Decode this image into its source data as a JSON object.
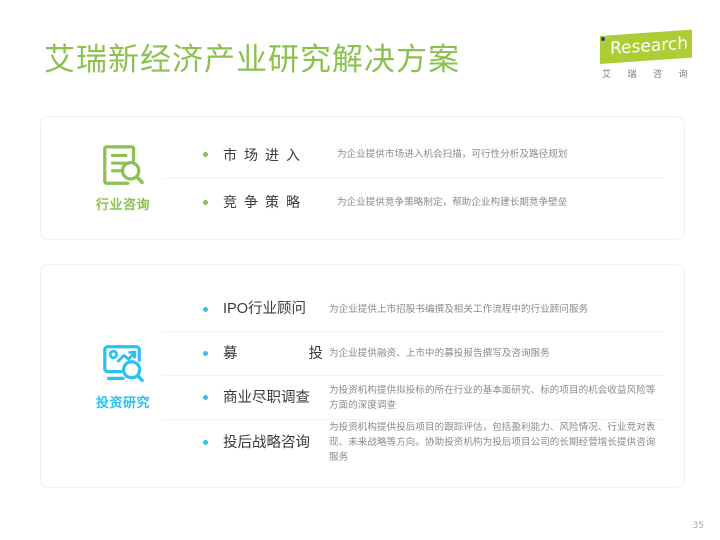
{
  "header": {
    "title": "艾瑞新经济产业研究解决方案",
    "title_color": "#8cc152",
    "logo": {
      "word": "Research",
      "cn": "艾 瑞 咨 询",
      "shape_color": "#aecc35",
      "dot_color": "#2c3e8f"
    }
  },
  "cards": [
    {
      "id": "industry",
      "icon_name": "document-search-icon",
      "label": "行业咨询",
      "accent": "#8cc152",
      "rows": [
        {
          "title": "市场进入",
          "desc": "为企业提供市场进入机会扫描，可行性分析及路径规划"
        },
        {
          "title": "竞争策略",
          "desc": "为企业提供竞争策略制定，帮助企业构建长期竞争壁垒"
        }
      ]
    },
    {
      "id": "invest",
      "icon_name": "chart-search-icon",
      "label": "投资研究",
      "accent": "#2ec0f0",
      "rows": [
        {
          "title": "IPO行业顾问",
          "desc": "为企业提供上市招股书编撰及相关工作流程中的行业顾问服务"
        },
        {
          "title_left": "募",
          "title_right": "投",
          "title": "募投",
          "desc": "为企业提供融资、上市中的募投报告撰写及咨询服务"
        },
        {
          "title": "商业尽职调查",
          "desc": "为投资机构提供拟投标的所在行业的基本面研究、标的项目的机会收益风险等方面的深度调查"
        },
        {
          "title": "投后战略咨询",
          "desc": "为投资机构提供投后项目的跟踪评估，包括盈利能力、风险情况、行业竞对表现、未来战略等方向。协助投资机构为投后项目公司的长期经营增长提供咨询服务"
        }
      ]
    }
  ],
  "footer": {
    "page_number": "35"
  }
}
